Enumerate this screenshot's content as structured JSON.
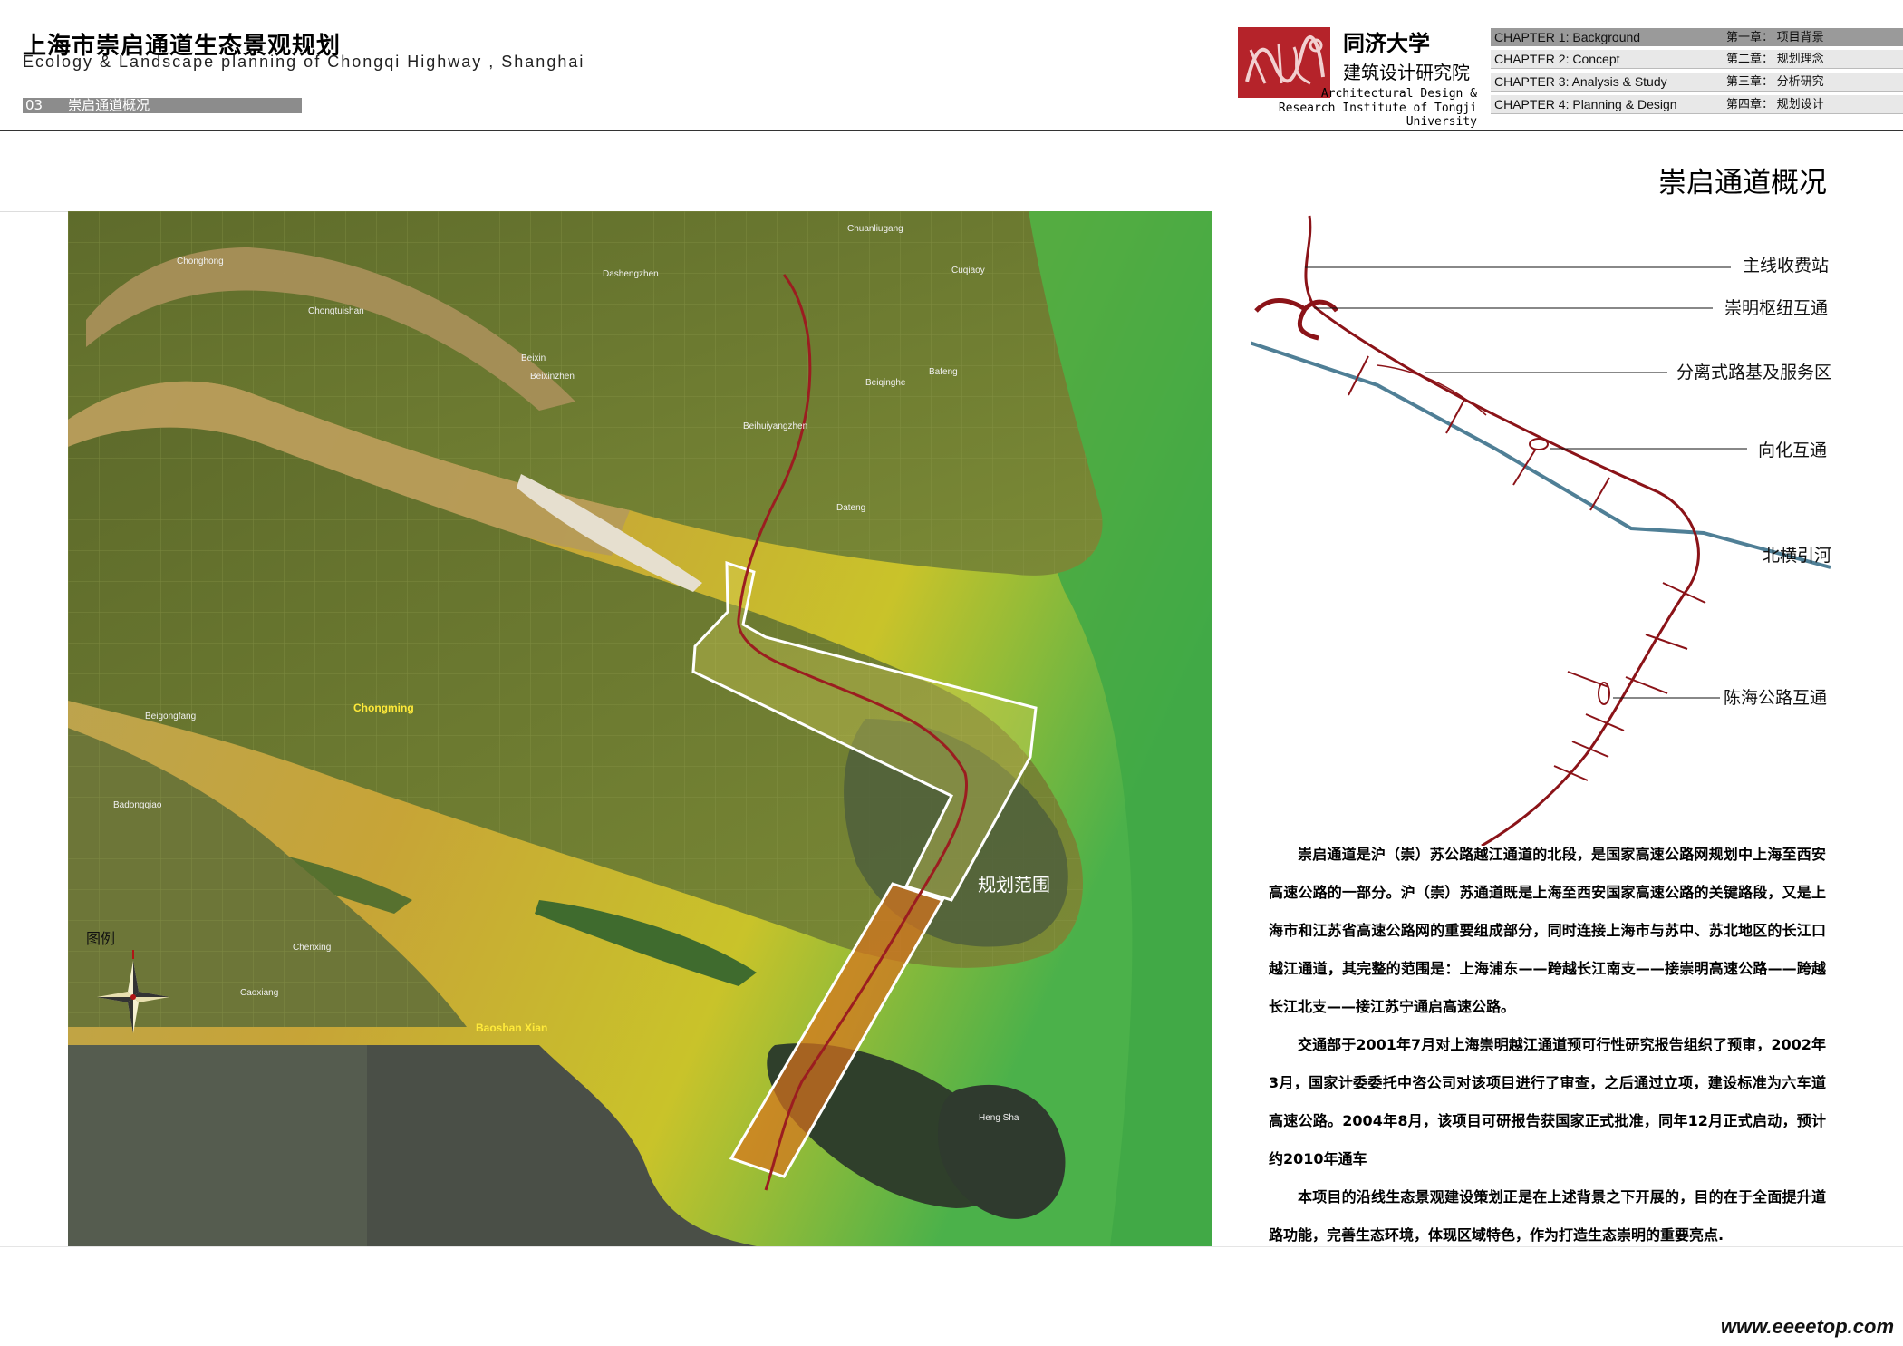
{
  "header": {
    "title_cn": "上海市崇启通道生态景观规划",
    "title_en": "Ecology & Landscape planning of Chongqi Highway , Shanghai",
    "section_no": "03",
    "section_name": "崇启通道概况"
  },
  "institute": {
    "name_cn_1": "同济大学",
    "name_cn_2": "建筑设计研究院",
    "name_en_1": "Architectural Design &",
    "name_en_2": "Research Institute of Tongji University"
  },
  "chapters": [
    {
      "en": "CHAPTER 1:  Background",
      "cn": "第一章：  项目背景",
      "active": true
    },
    {
      "en": "CHAPTER 2:  Concept",
      "cn": "第二章：  规划理念",
      "active": false
    },
    {
      "en": "CHAPTER 3:  Analysis & Study",
      "cn": "第三章：  分析研究",
      "active": false
    },
    {
      "en": "CHAPTER 4:  Planning & Design",
      "cn": "第四章：  规划设计",
      "active": false
    }
  ],
  "page_heading": "崇启通道概况",
  "map": {
    "range_label": "规划范围",
    "legend_label": "图例",
    "places": [
      "Chonghong",
      "Chongtuishan",
      "Beixin",
      "Beixinzhen",
      "Dashengzhen",
      "Chuanliugang",
      "Cuqiaoy",
      "Bafeng",
      "Beiqinghe",
      "Beihuiyangzhen",
      "Dateng",
      "Chongming",
      "Beigongfang",
      "Badongqiao",
      "Chenxing",
      "Caoxiang",
      "Baoshan Xian",
      "Heng Sha"
    ]
  },
  "diagram": {
    "labels": [
      "主线收费站",
      "崇明枢纽互通",
      "分离式路基及服务区",
      "向化互通",
      "北横引河",
      "陈海公路互通"
    ],
    "colors": {
      "road": "#8b1318",
      "river": "#4f7f96"
    }
  },
  "body": {
    "paragraphs": [
      "崇启通道是沪（崇）苏公路越江通道的北段，是国家高速公路网规划中上海至西安高速公路的一部分。沪（崇）苏通道既是上海至西安国家高速公路的关键路段，又是上海市和江苏省高速公路网的重要组成部分，同时连接上海市与苏中、苏北地区的长江口越江通道，其完整的范围是：上海浦东——跨越长江南支——接崇明高速公路——跨越长江北支——接江苏宁通启高速公路。",
      "交通部于2001年7月对上海崇明越江通道预可行性研究报告组织了预审，2002年3月，国家计委委托中咨公司对该项目进行了审查，之后通过立项，建设标准为六车道高速公路。2004年8月，该项目可研报告获国家正式批准，同年12月正式启动，预计约2010年通车",
      "本项目的沿线生态景观建设策划正是在上述背景之下开展的，目的在于全面提升道路功能，完善生态环境，体现区域特色，作为打造生态崇明的重要亮点."
    ]
  },
  "watermark": "www.eeeetop.com"
}
